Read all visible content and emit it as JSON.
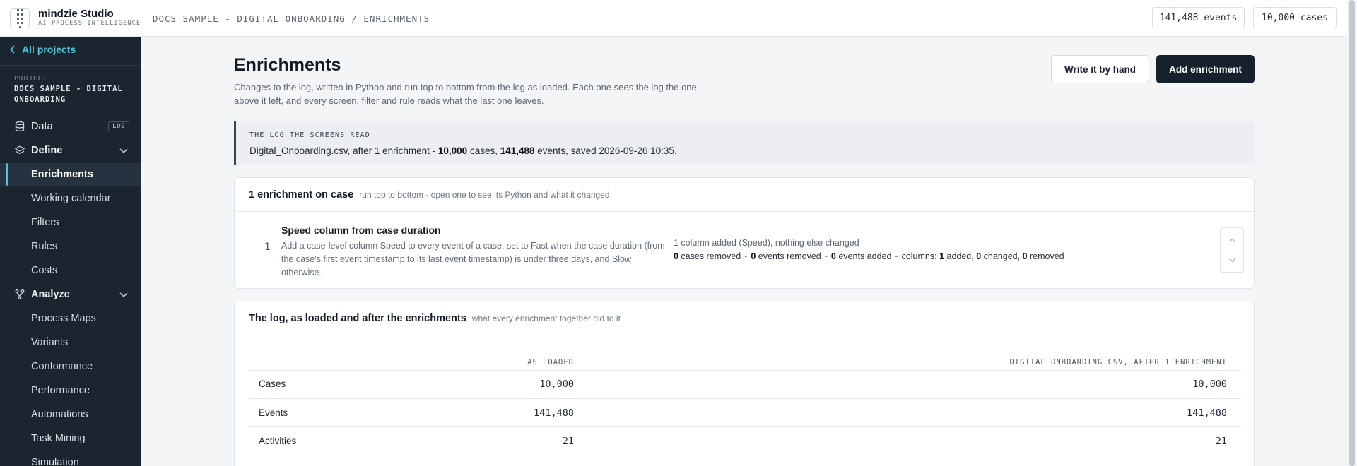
{
  "topbar": {
    "brand_name": "mindzie Studio",
    "brand_sub": "AI PROCESS INTELLIGENCE",
    "breadcrumb": "DOCS SAMPLE - DIGITAL ONBOARDING / ENRICHMENTS",
    "events_chip": "141,488 events",
    "cases_chip": "10,000 cases"
  },
  "sidebar": {
    "all_projects": "All projects",
    "project_label": "PROJECT",
    "project_name": "DOCS SAMPLE - DIGITAL ONBOARDING",
    "data": {
      "label": "Data",
      "badge": "LOG"
    },
    "define": {
      "label": "Define",
      "items": [
        "Enrichments",
        "Working calendar",
        "Filters",
        "Rules",
        "Costs"
      ]
    },
    "analyze": {
      "label": "Analyze",
      "items": [
        "Process Maps",
        "Variants",
        "Conformance",
        "Performance",
        "Automations",
        "Task Mining",
        "Simulation"
      ]
    }
  },
  "page": {
    "title": "Enrichments",
    "description": "Changes to the log, written in Python and run top to bottom from the log as loaded. Each one sees the log the one above it left, and every screen, filter and rule reads what the last one leaves.",
    "write_by_hand": "Write it by hand",
    "add_enrichment": "Add enrichment"
  },
  "callout": {
    "label": "THE LOG THE SCREENS READ",
    "file": "Digital_Onboarding.csv, after 1 enrichment - ",
    "cases": "10,000",
    "cases_word": " cases, ",
    "events": "141,488",
    "events_word": " events, saved 2026-09-26 10:35."
  },
  "enrichments_card": {
    "title": "1 enrichment on case",
    "hint": "run top to bottom - open one to see its Python and what it changed",
    "item": {
      "number": "1",
      "title": "Speed column from case duration",
      "description": "Add a case-level column Speed to every event of a case, set to Fast when the case duration (from the case's first event timestamp to its last event timestamp) is under three days, and Slow otherwise.",
      "summary": "1 column added (Speed), nothing else changed",
      "cases_removed": "0",
      "cases_removed_label": " cases removed",
      "events_removed": "0",
      "events_removed_label": " events removed",
      "events_added": "0",
      "events_added_label": " events added",
      "columns_label": "columns: ",
      "cols_added": "1",
      "cols_added_label": " added, ",
      "cols_changed": "0",
      "cols_changed_label": " changed, ",
      "cols_removed": "0",
      "cols_removed_label": " removed",
      "dash": "-"
    }
  },
  "log_card": {
    "title": "The log, as loaded and after the enrichments",
    "hint": "what every enrichment together did to it",
    "col_loaded": "AS LOADED",
    "col_after": "DIGITAL_ONBOARDING.CSV, AFTER 1 ENRICHMENT",
    "rows": [
      {
        "label": "Cases",
        "loaded": "10,000",
        "after": "10,000"
      },
      {
        "label": "Events",
        "loaded": "141,488",
        "after": "141,488"
      },
      {
        "label": "Activities",
        "loaded": "21",
        "after": "21"
      }
    ]
  },
  "colors": {
    "sidebar_bg": "#1b2530",
    "accent": "#4fc3d8",
    "primary_button": "#17212e"
  }
}
